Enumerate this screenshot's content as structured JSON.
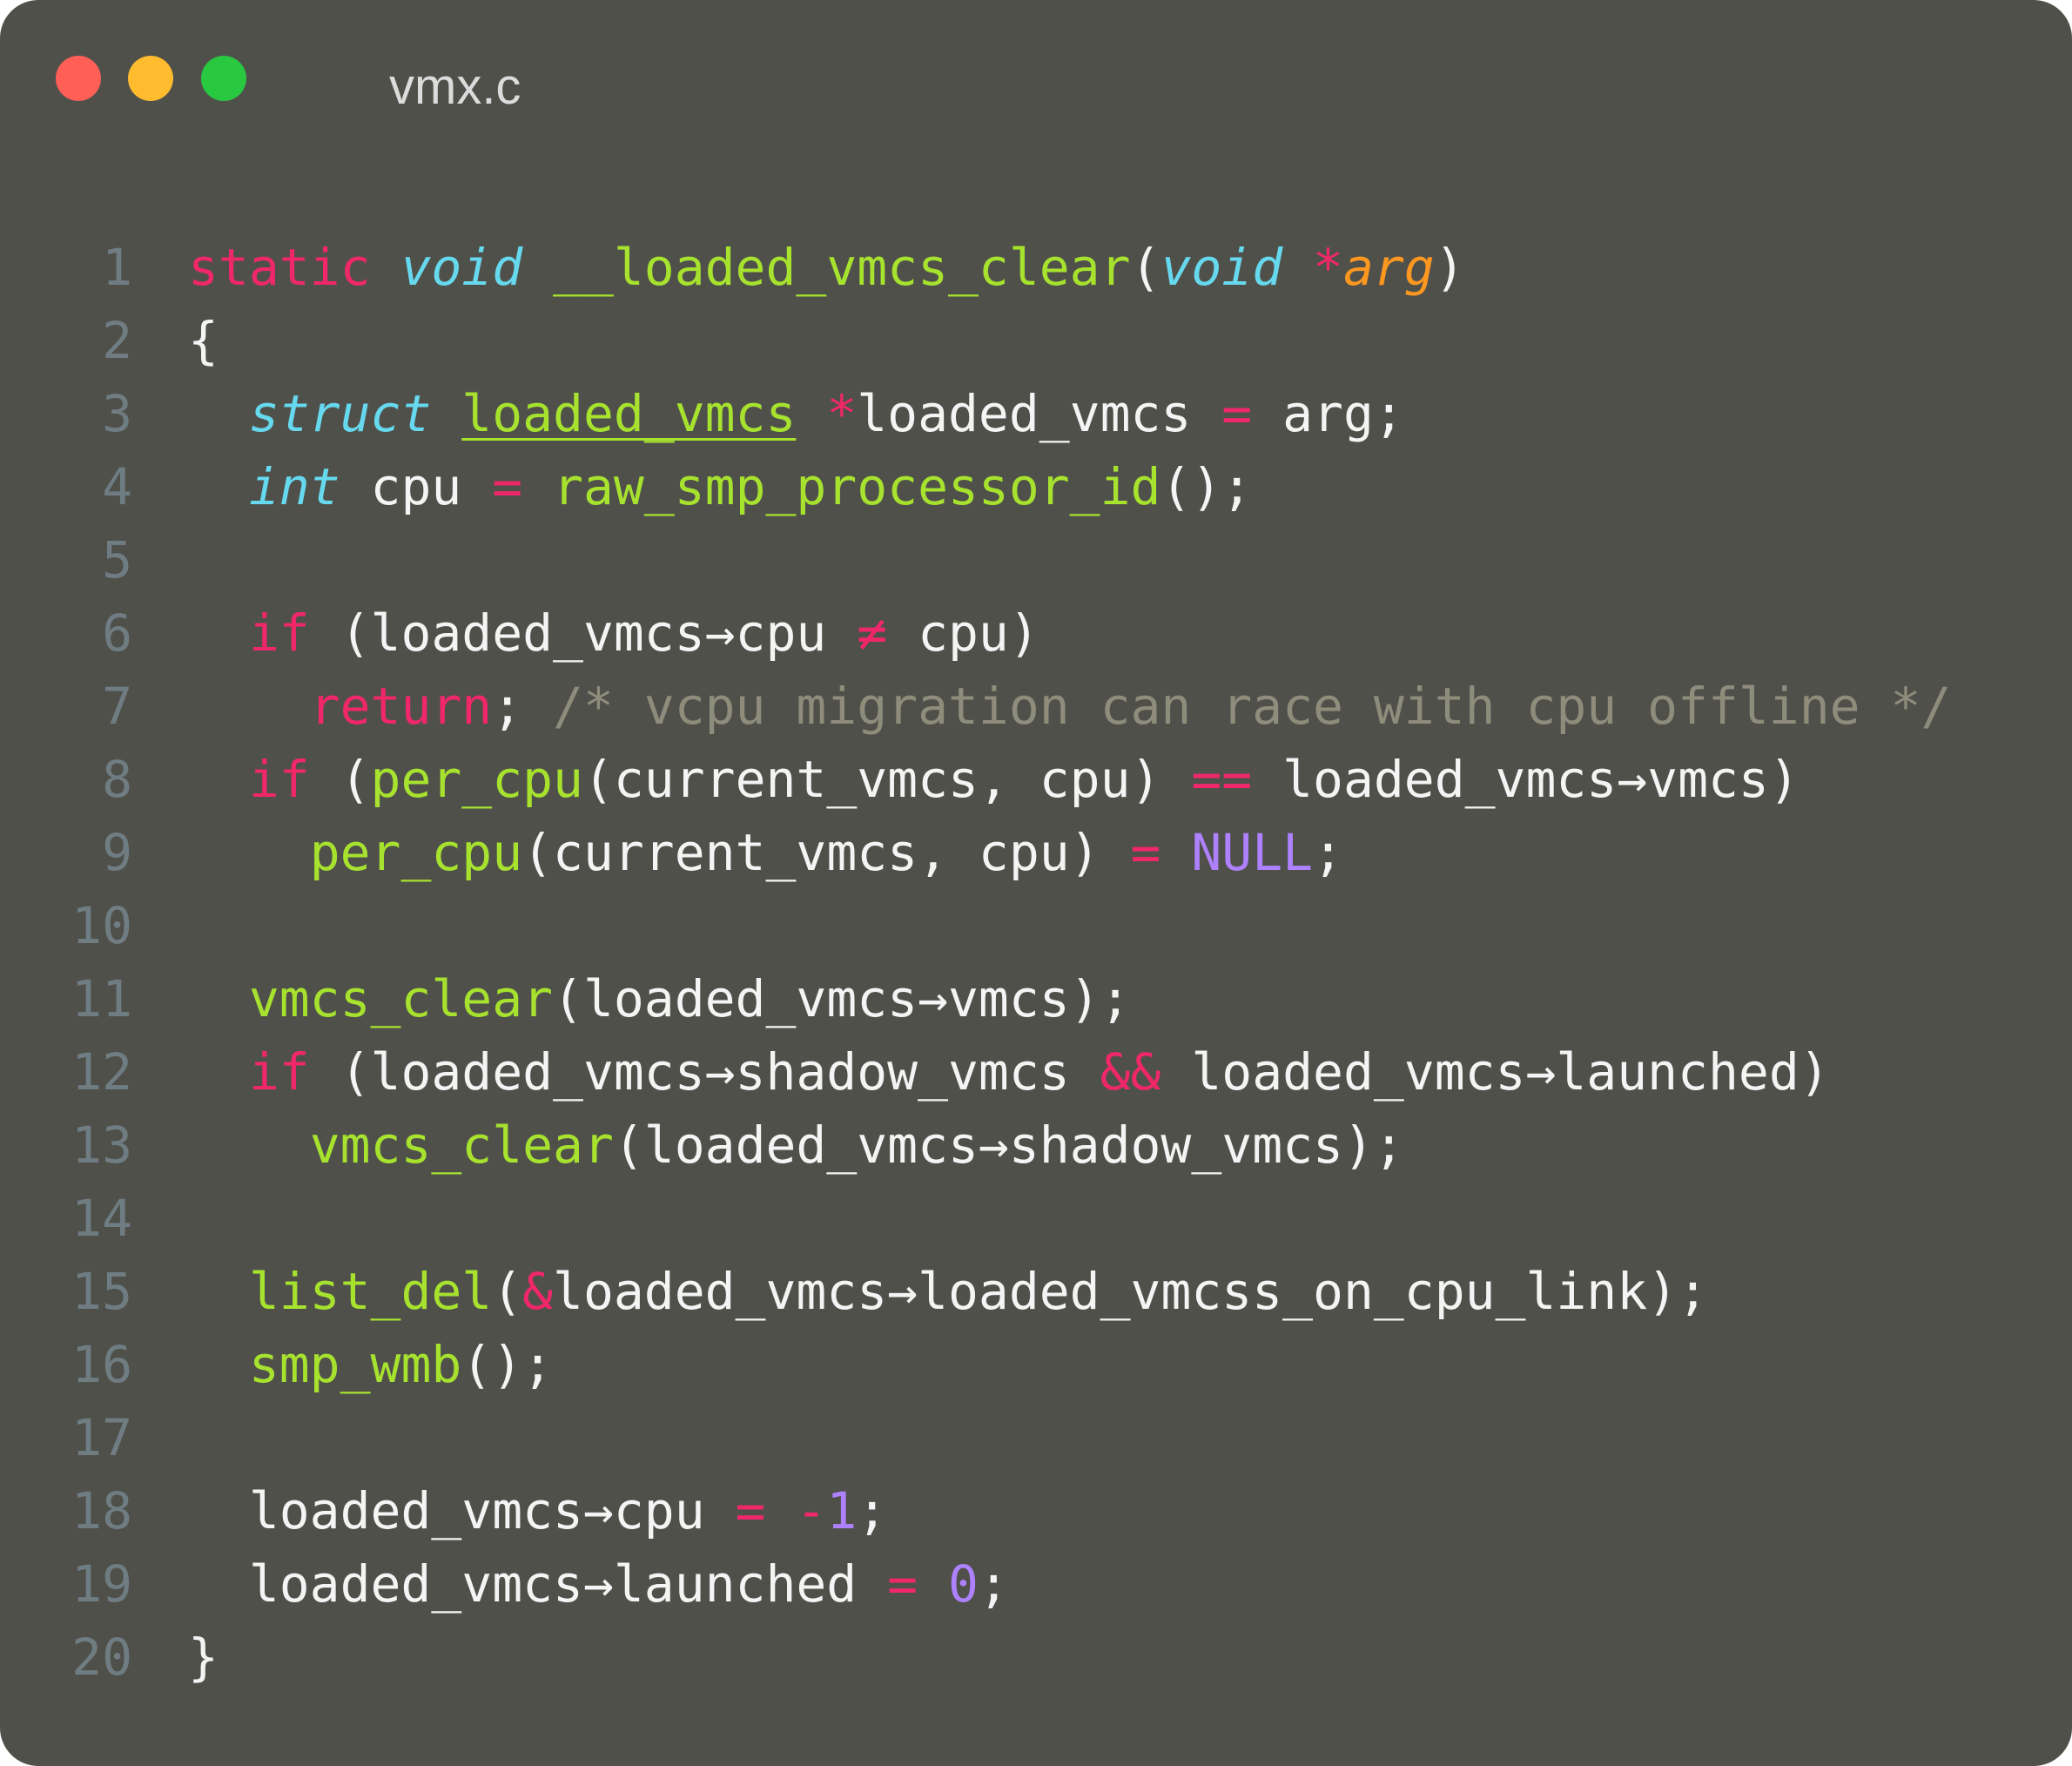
{
  "window": {
    "title": "vmx.c",
    "controls": {
      "close_color": "#ff5f57",
      "minimize_color": "#febc2e",
      "zoom_color": "#28c840"
    }
  },
  "colors": {
    "background": "#50504b",
    "line_number": "#6f7d83",
    "plain": "#f4f4f4",
    "keyword": "#f0276a",
    "type": "#66d9ef",
    "function": "#a6e22e",
    "parameter": "#fd971f",
    "constant": "#ae81ff",
    "comment": "#8e8c7b"
  },
  "code": {
    "lines": [
      {
        "n": "1",
        "tokens": [
          {
            "t": "static",
            "c": "keyword"
          },
          {
            "t": " ",
            "c": "plain"
          },
          {
            "t": "void",
            "c": "type",
            "s": "i"
          },
          {
            "t": " ",
            "c": "plain"
          },
          {
            "t": "__loaded_vmcs_clear",
            "c": "function"
          },
          {
            "t": "(",
            "c": "plain"
          },
          {
            "t": "void",
            "c": "type",
            "s": "i"
          },
          {
            "t": " ",
            "c": "plain"
          },
          {
            "t": "*",
            "c": "keyword"
          },
          {
            "t": "arg",
            "c": "parameter",
            "s": "i"
          },
          {
            "t": ")",
            "c": "plain"
          }
        ]
      },
      {
        "n": "2",
        "tokens": [
          {
            "t": "{",
            "c": "plain"
          }
        ]
      },
      {
        "n": "3",
        "tokens": [
          {
            "t": "  ",
            "c": "plain"
          },
          {
            "t": "struct",
            "c": "type",
            "s": "i"
          },
          {
            "t": " ",
            "c": "plain"
          },
          {
            "t": "loaded_vmcs",
            "c": "function",
            "s": "u"
          },
          {
            "t": " ",
            "c": "plain"
          },
          {
            "t": "*",
            "c": "keyword"
          },
          {
            "t": "loaded_vmcs ",
            "c": "plain"
          },
          {
            "t": "=",
            "c": "keyword"
          },
          {
            "t": " arg;",
            "c": "plain"
          }
        ]
      },
      {
        "n": "4",
        "tokens": [
          {
            "t": "  ",
            "c": "plain"
          },
          {
            "t": "int",
            "c": "type",
            "s": "i"
          },
          {
            "t": " cpu ",
            "c": "plain"
          },
          {
            "t": "=",
            "c": "keyword"
          },
          {
            "t": " ",
            "c": "plain"
          },
          {
            "t": "raw_smp_processor_id",
            "c": "function"
          },
          {
            "t": "();",
            "c": "plain"
          }
        ]
      },
      {
        "n": "5",
        "tokens": []
      },
      {
        "n": "6",
        "tokens": [
          {
            "t": "  ",
            "c": "plain"
          },
          {
            "t": "if",
            "c": "keyword"
          },
          {
            "t": " (loaded_vmcs→cpu ",
            "c": "plain"
          },
          {
            "t": "≠",
            "c": "keyword"
          },
          {
            "t": " cpu)",
            "c": "plain"
          }
        ]
      },
      {
        "n": "7",
        "tokens": [
          {
            "t": "    ",
            "c": "plain"
          },
          {
            "t": "return",
            "c": "keyword"
          },
          {
            "t": "; ",
            "c": "plain"
          },
          {
            "t": "/* vcpu migration can race with cpu offline */",
            "c": "comment"
          }
        ]
      },
      {
        "n": "8",
        "tokens": [
          {
            "t": "  ",
            "c": "plain"
          },
          {
            "t": "if",
            "c": "keyword"
          },
          {
            "t": " (",
            "c": "plain"
          },
          {
            "t": "per_cpu",
            "c": "function"
          },
          {
            "t": "(current_vmcs, cpu) ",
            "c": "plain"
          },
          {
            "t": "==",
            "c": "keyword"
          },
          {
            "t": " loaded_vmcs→vmcs)",
            "c": "plain"
          }
        ]
      },
      {
        "n": "9",
        "tokens": [
          {
            "t": "    ",
            "c": "plain"
          },
          {
            "t": "per_cpu",
            "c": "function"
          },
          {
            "t": "(current_vmcs, cpu) ",
            "c": "plain"
          },
          {
            "t": "=",
            "c": "keyword"
          },
          {
            "t": " ",
            "c": "plain"
          },
          {
            "t": "NULL",
            "c": "constant"
          },
          {
            "t": ";",
            "c": "plain"
          }
        ]
      },
      {
        "n": "10",
        "tokens": []
      },
      {
        "n": "11",
        "tokens": [
          {
            "t": "  ",
            "c": "plain"
          },
          {
            "t": "vmcs_clear",
            "c": "function"
          },
          {
            "t": "(loaded_vmcs→vmcs);",
            "c": "plain"
          }
        ]
      },
      {
        "n": "12",
        "tokens": [
          {
            "t": "  ",
            "c": "plain"
          },
          {
            "t": "if",
            "c": "keyword"
          },
          {
            "t": " (loaded_vmcs→shadow_vmcs ",
            "c": "plain"
          },
          {
            "t": "&&",
            "c": "keyword"
          },
          {
            "t": " loaded_vmcs→launched)",
            "c": "plain"
          }
        ]
      },
      {
        "n": "13",
        "tokens": [
          {
            "t": "    ",
            "c": "plain"
          },
          {
            "t": "vmcs_clear",
            "c": "function"
          },
          {
            "t": "(loaded_vmcs→shadow_vmcs);",
            "c": "plain"
          }
        ]
      },
      {
        "n": "14",
        "tokens": []
      },
      {
        "n": "15",
        "tokens": [
          {
            "t": "  ",
            "c": "plain"
          },
          {
            "t": "list_del",
            "c": "function"
          },
          {
            "t": "(",
            "c": "plain"
          },
          {
            "t": "&",
            "c": "keyword"
          },
          {
            "t": "loaded_vmcs→loaded_vmcss_on_cpu_link);",
            "c": "plain"
          }
        ]
      },
      {
        "n": "16",
        "tokens": [
          {
            "t": "  ",
            "c": "plain"
          },
          {
            "t": "smp_wmb",
            "c": "function"
          },
          {
            "t": "();",
            "c": "plain"
          }
        ]
      },
      {
        "n": "17",
        "tokens": []
      },
      {
        "n": "18",
        "tokens": [
          {
            "t": "  loaded_vmcs→cpu ",
            "c": "plain"
          },
          {
            "t": "=",
            "c": "keyword"
          },
          {
            "t": " ",
            "c": "plain"
          },
          {
            "t": "-",
            "c": "keyword"
          },
          {
            "t": "1",
            "c": "constant"
          },
          {
            "t": ";",
            "c": "plain"
          }
        ]
      },
      {
        "n": "19",
        "tokens": [
          {
            "t": "  loaded_vmcs→launched ",
            "c": "plain"
          },
          {
            "t": "=",
            "c": "keyword"
          },
          {
            "t": " ",
            "c": "plain"
          },
          {
            "t": "0",
            "c": "constant"
          },
          {
            "t": ";",
            "c": "plain"
          }
        ]
      },
      {
        "n": "20",
        "tokens": [
          {
            "t": "}",
            "c": "plain"
          }
        ]
      }
    ]
  }
}
